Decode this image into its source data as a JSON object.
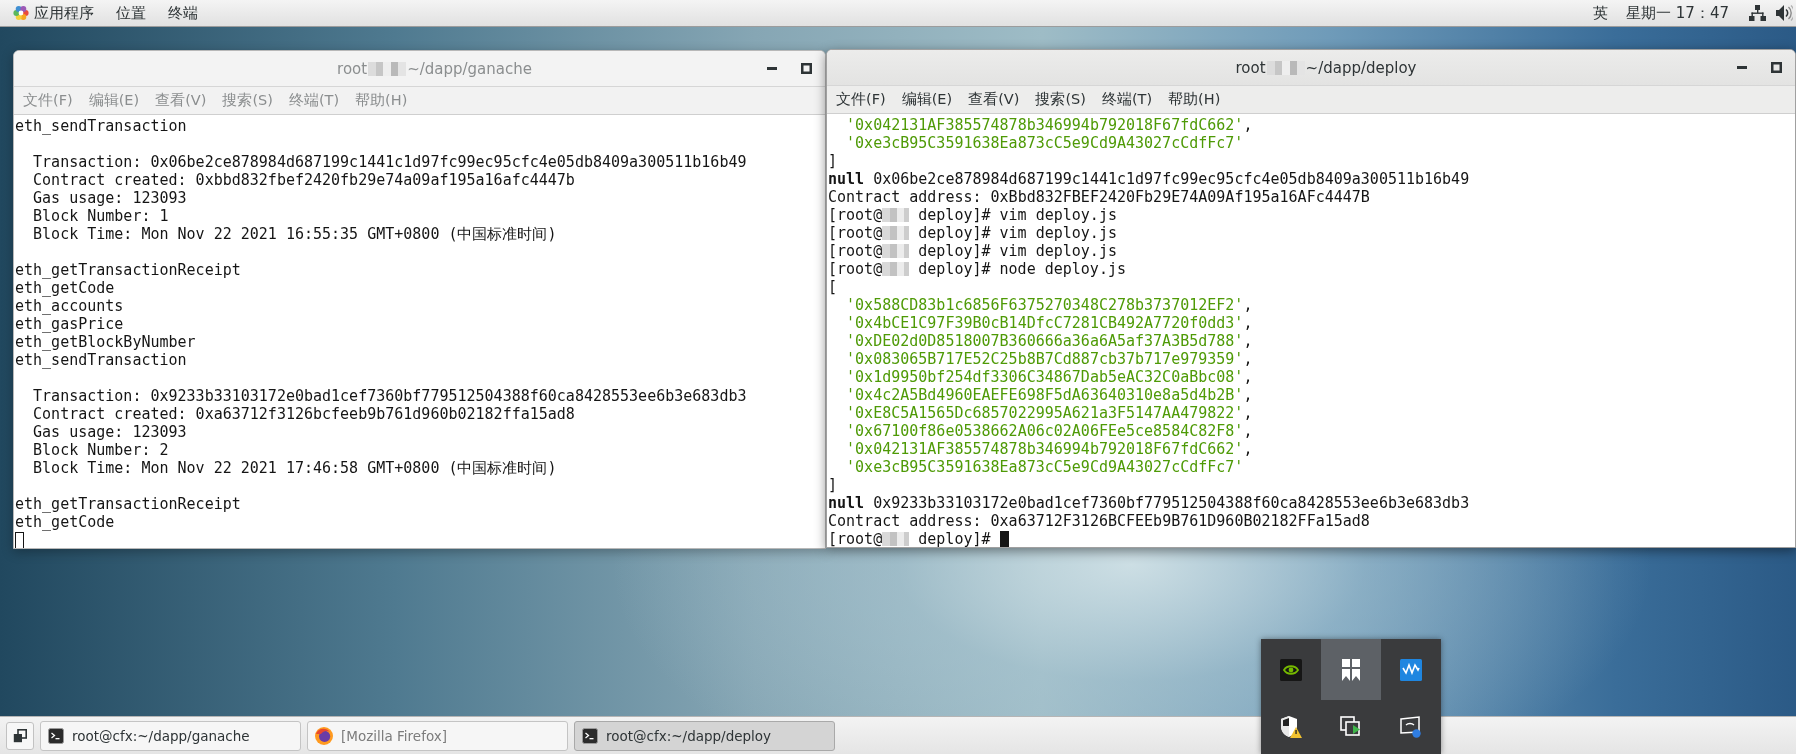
{
  "top_bar": {
    "menus": [
      {
        "label": "应用程序",
        "kind": "apps"
      },
      {
        "label": "位置",
        "kind": "menu"
      },
      {
        "label": "终端",
        "kind": "menu"
      }
    ],
    "input_method": "英",
    "clock": "星期一 17：47"
  },
  "windows": [
    {
      "title_start": "root",
      "title_end": "~/dapp/ganache",
      "focused": false,
      "menu": [
        "文件(F)",
        "编辑(E)",
        "查看(V)",
        "搜索(S)",
        "终端(T)",
        "帮助(H)"
      ],
      "lines": [
        {
          "kind": "text",
          "text": "eth_sendTransaction"
        },
        {
          "kind": "blank"
        },
        {
          "kind": "detail",
          "text": "Transaction: 0x06be2ce878984d687199c1441c1d97fc99ec95cfc4e05db8409a300511b16b49"
        },
        {
          "kind": "detail",
          "text": "Contract created: 0xbbd832fbef2420fb29e74a09af195a16afc4447b"
        },
        {
          "kind": "detail",
          "text": "Gas usage: 123093"
        },
        {
          "kind": "detail",
          "text": "Block Number: 1"
        },
        {
          "kind": "detail",
          "text": "Block Time: Mon Nov 22 2021 16:55:35 GMT+0800 (中国标准时间)"
        },
        {
          "kind": "blank"
        },
        {
          "kind": "text",
          "text": "eth_getTransactionReceipt"
        },
        {
          "kind": "text",
          "text": "eth_getCode"
        },
        {
          "kind": "text",
          "text": "eth_accounts"
        },
        {
          "kind": "text",
          "text": "eth_gasPrice"
        },
        {
          "kind": "text",
          "text": "eth_getBlockByNumber"
        },
        {
          "kind": "text",
          "text": "eth_sendTransaction"
        },
        {
          "kind": "blank"
        },
        {
          "kind": "detail",
          "text": "Transaction: 0x9233b33103172e0bad1cef7360bf779512504388f60ca8428553ee6b3e683db3"
        },
        {
          "kind": "detail",
          "text": "Contract created: 0xa63712f3126bcfeeb9b761d960b02182ffa15ad8"
        },
        {
          "kind": "detail",
          "text": "Gas usage: 123093"
        },
        {
          "kind": "detail",
          "text": "Block Number: 2"
        },
        {
          "kind": "detail",
          "text": "Block Time: Mon Nov 22 2021 17:46:58 GMT+0800 (中国标准时间)"
        },
        {
          "kind": "blank"
        },
        {
          "kind": "text",
          "text": "eth_getTransactionReceipt"
        },
        {
          "kind": "text",
          "text": "eth_getCode"
        },
        {
          "kind": "cursor"
        }
      ]
    },
    {
      "title_start": "root",
      "title_end": "~/dapp/deploy",
      "focused": true,
      "menu": [
        "文件(F)",
        "编辑(E)",
        "查看(V)",
        "搜索(S)",
        "终端(T)",
        "帮助(H)"
      ],
      "lines": [
        {
          "kind": "address",
          "text": "'0x042131AF385574878b346994b792018F67fdC662'",
          "suffix": ","
        },
        {
          "kind": "address",
          "text": "'0xe3cB95C3591638Ea873cC5e9Cd9A43027cCdfFc7'"
        },
        {
          "kind": "text",
          "text": "]"
        },
        {
          "kind": "text",
          "text": "**null** 0x06be2ce878984d687199c1441c1d97fc99ec95cfc4e05db8409a300511b16b49"
        },
        {
          "kind": "text",
          "text": "Contract address: 0xBbd832FBEF2420Fb29E74A09Af195a16AFc4447B"
        },
        {
          "kind": "prompt",
          "before": "[root@",
          "after": "deploy]# vim deploy.js",
          "cursor": false
        },
        {
          "kind": "prompt",
          "before": "[root@",
          "after": "deploy]# vim deploy.js",
          "cursor": false
        },
        {
          "kind": "prompt",
          "before": "[root@",
          "after": "deploy]# vim deploy.js",
          "cursor": false
        },
        {
          "kind": "prompt",
          "before": "[root@",
          "after": "deploy]# node deploy.js",
          "cursor": false
        },
        {
          "kind": "text",
          "text": "["
        },
        {
          "kind": "address",
          "text": "'0x588CD83b1c6856F6375270348C278b3737012EF2'",
          "suffix": ","
        },
        {
          "kind": "address",
          "text": "'0x4bCE1C97F39B0cB14DfcC7281CB492A7720f0dd3'",
          "suffix": ","
        },
        {
          "kind": "address",
          "text": "'0xDE02d0D8518007B360666a36a6A5af37A3B5d788'",
          "suffix": ","
        },
        {
          "kind": "address",
          "text": "'0x083065B717E52C25b8B7Cd887cb37b717e979359'",
          "suffix": ","
        },
        {
          "kind": "address",
          "text": "'0x1d9950bf254df3306C34867Dab5eAC32C0aBbc08'",
          "suffix": ","
        },
        {
          "kind": "address",
          "text": "'0x4c2A5Bd4960EAEFE698F5dA63640310e8a5d4b2B'",
          "suffix": ","
        },
        {
          "kind": "address",
          "text": "'0xE8C5A1565Dc6857022995A621a3F5147AA479822'",
          "suffix": ","
        },
        {
          "kind": "address",
          "text": "'0x67100f86e0538662A06c02A06FEe5ce8584C82F8'",
          "suffix": ","
        },
        {
          "kind": "address",
          "text": "'0x042131AF385574878b346994b792018F67fdC662'",
          "suffix": ","
        },
        {
          "kind": "address",
          "text": "'0xe3cB95C3591638Ea873cC5e9Cd9A43027cCdfFc7'"
        },
        {
          "kind": "text",
          "text": "]"
        },
        {
          "kind": "text",
          "text": "**null** 0x9233b33103172e0bad1cef7360bf779512504388f60ca8428553ee6b3e683db3"
        },
        {
          "kind": "text",
          "text": "Contract address: 0xa63712F3126BCFEEb9B761D960B02182FFa15ad8"
        },
        {
          "kind": "prompt",
          "before": "[root@",
          "after": "deploy]#",
          "cursor": true
        }
      ]
    }
  ],
  "tray_popup": {
    "items": [
      {
        "kind": "eye-logo",
        "highlighted": false
      },
      {
        "kind": "ribbon",
        "highlighted": true
      },
      {
        "kind": "waveform",
        "highlighted": false
      },
      {
        "kind": "shield-warning",
        "highlighted": false
      },
      {
        "kind": "window-stack",
        "highlighted": false
      },
      {
        "kind": "monitor",
        "highlighted": false
      }
    ]
  },
  "taskbar": {
    "buttons": [
      {
        "label": "root@cfx:~/dapp/ganache",
        "kind": "terminal",
        "selected": false,
        "minimized": false
      },
      {
        "label": "[Mozilla Firefox]",
        "kind": "browser",
        "selected": false,
        "minimized": true
      },
      {
        "label": "root@cfx:~/dapp/deploy",
        "kind": "terminal",
        "selected": true,
        "minimized": false
      }
    ]
  }
}
